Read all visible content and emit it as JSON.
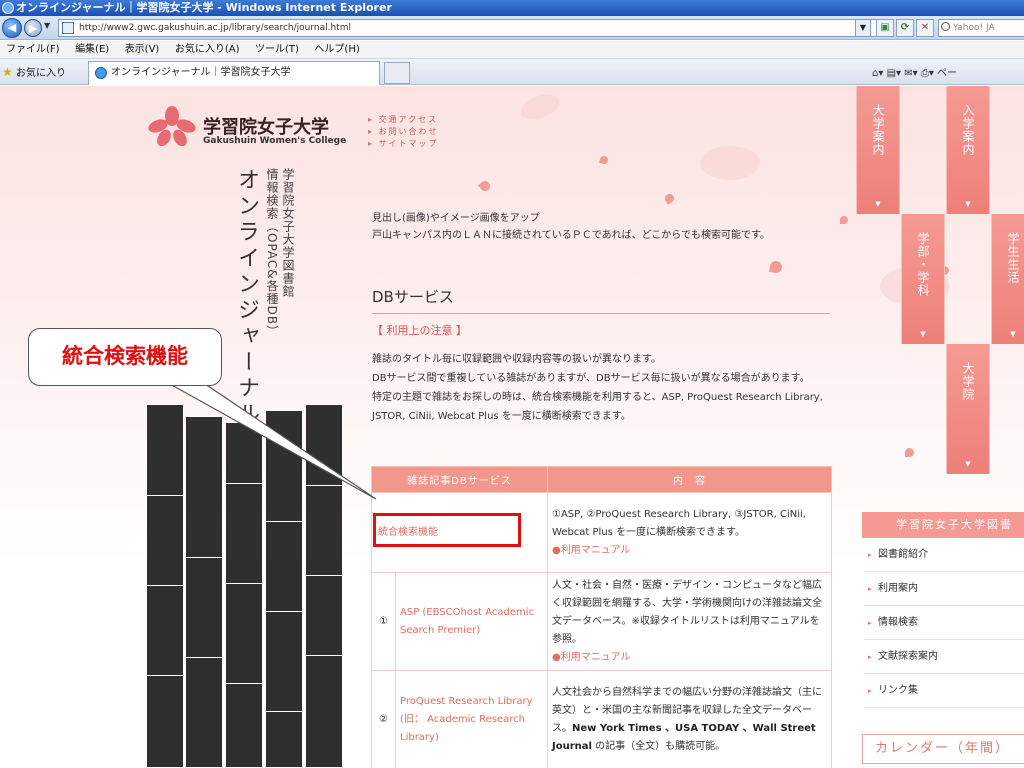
{
  "browser": {
    "title": "オンラインジャーナル｜学習院女子大学 - Windows Internet Explorer",
    "url": "http://www2.gwc.gakushuin.ac.jp/library/search/journal.html",
    "search_placeholder": "Yahoo! JA",
    "menu": [
      "ファイル(F)",
      "編集(E)",
      "表示(V)",
      "お気に入り(A)",
      "ツール(T)",
      "ヘルプ(H)"
    ],
    "favorites_label": "お気に入り",
    "tab_title": "オンラインジャーナル｜学習院女子大学",
    "command_bar": "ペー"
  },
  "site": {
    "logo_jp": "学習院女子大学",
    "logo_en": "Gakushuin Women's College",
    "util_links": [
      "交通アクセス",
      "お問い合わせ",
      "サイトマップ"
    ],
    "vertical_title": "オンラインジャーナル",
    "vertical_sub1": "学習院女子大学図書館",
    "vertical_sub2": "情報検索（OPAC&各種DB）"
  },
  "callout": {
    "text": "統合検索機能"
  },
  "content": {
    "intro_line1": "見出し(画像)やイメージ画像をアップ",
    "intro_line2": "戸山キャンパス内のＬＡＮに接続されているＰＣであれば、どこからでも検索可能です。",
    "db_heading": "DBサービス",
    "caution": "【 利用上の注意 】",
    "notes": [
      "雑誌のタイトル毎に収録範囲や収録内容等の扱いが異なります。",
      "DBサービス間で重複している雑誌がありますが、DBサービス毎に扱いが異なる場合があります。",
      "特定の主題で雑誌をお探しの時は、統合検索機能を利用すると、ASP, ProQuest Research Library, JSTOR, CiNii, Webcat Plus を一度に横断検索できます。"
    ]
  },
  "table": {
    "headers": [
      "雑誌記事DBサービス",
      "内　容"
    ],
    "rows": [
      {
        "num": "",
        "name": "統合検索機能",
        "desc": "①ASP, ②ProQuest Research Library, ③JSTOR, CiNii, Webcat Plus を一度に横断検索できます。",
        "manual": "●利用マニュアル"
      },
      {
        "num": "①",
        "name": "ASP (EBSCOhost Academic Search Premier)",
        "desc": "人文・社会・自然・医療・デザイン・コンピュータなど幅広く収録範囲を網羅する、大学・学術機関向けの洋雑誌論文全文データベース。※収録タイトルリストは利用マニュアルを参照。",
        "manual": "●利用マニュアル"
      },
      {
        "num": "②",
        "name": "ProQuest Research Library (旧： Academic Research Library)",
        "desc_pre": "人文社会から自然科学までの幅広い分野の洋雑誌論文（主に英文）と・米国の主な新聞記事を収録した全文データベース。",
        "desc_bold": "New York Times 、USA TODAY 、Wall Street Journal",
        "desc_post": " の記事（全文）も購読可能。"
      }
    ]
  },
  "right_nav": {
    "tabs": [
      "大学案内",
      "入学案内",
      "学部・学科",
      "学生生活",
      "大学院"
    ],
    "arrow": "▼",
    "library_title": "学習院女子大学図書",
    "library_items": [
      "図書館紹介",
      "利用案内",
      "情報検索",
      "文献探索案内",
      "リンク集"
    ],
    "calendar_title": "カレンダー（年間）"
  },
  "colors": {
    "accent": "#f3978c",
    "callout_red": "#e01010",
    "link": "#e06d60"
  }
}
